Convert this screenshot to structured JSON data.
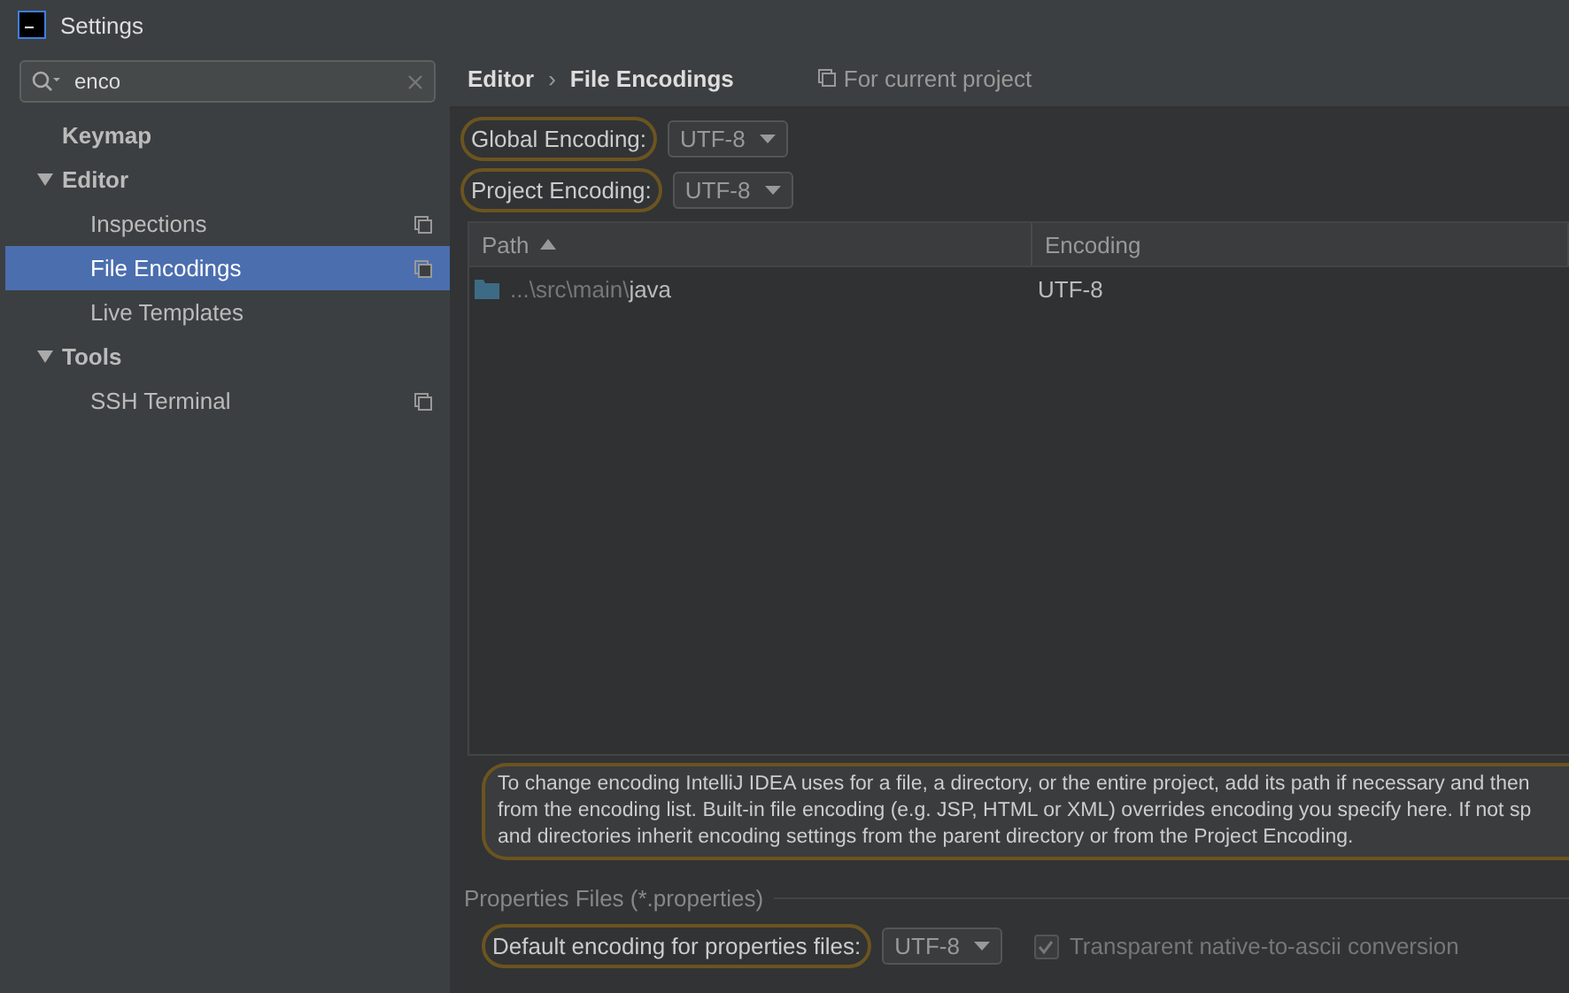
{
  "window": {
    "title": "Settings"
  },
  "search": {
    "value": "enco"
  },
  "tree": [
    {
      "label": "Keymap",
      "selected": false,
      "project_level": false
    },
    {
      "label": "Editor",
      "selected": false,
      "expanded": true,
      "project_level": false,
      "children": [
        {
          "label": "Inspections",
          "selected": false,
          "project_level": true
        },
        {
          "label": "File Encodings",
          "selected": true,
          "project_level": true
        },
        {
          "label": "Live Templates",
          "selected": false,
          "project_level": false
        }
      ]
    },
    {
      "label": "Tools",
      "selected": false,
      "expanded": true,
      "project_level": false,
      "children": [
        {
          "label": "SSH Terminal",
          "selected": false,
          "project_level": true
        }
      ]
    }
  ],
  "breadcrumb": [
    "Editor",
    "›",
    "File Encodings"
  ],
  "scope_note": "For current project",
  "encodings": [
    {
      "label": "Global Encoding:",
      "value": "UTF-8"
    },
    {
      "label": "Project Encoding:",
      "value": "UTF-8"
    }
  ],
  "table": {
    "columns": [
      {
        "label": "Path",
        "sorted": true
      },
      {
        "label": "Encoding",
        "sorted": false
      }
    ],
    "rows": [
      {
        "path_prefix": "...\\src\\main\\",
        "path_name": "java",
        "encoding": "UTF-8"
      }
    ]
  },
  "hint_lines": [
    "To change encoding IntelliJ IDEA uses for a file, a directory, or the entire project, add its path if necessary and then",
    "from the encoding list. Built-in file encoding (e.g. JSP, HTML or XML) overrides encoding you specify here. If not sp",
    "and directories inherit encoding settings from the parent directory or from the Project Encoding."
  ],
  "properties": {
    "title": "Properties Files (*.properties)",
    "label": "Default encoding for properties files:",
    "value": "UTF-8",
    "checkbox": {
      "label": "Transparent native-to-ascii conversion",
      "checked": true,
      "disabled": true
    }
  }
}
